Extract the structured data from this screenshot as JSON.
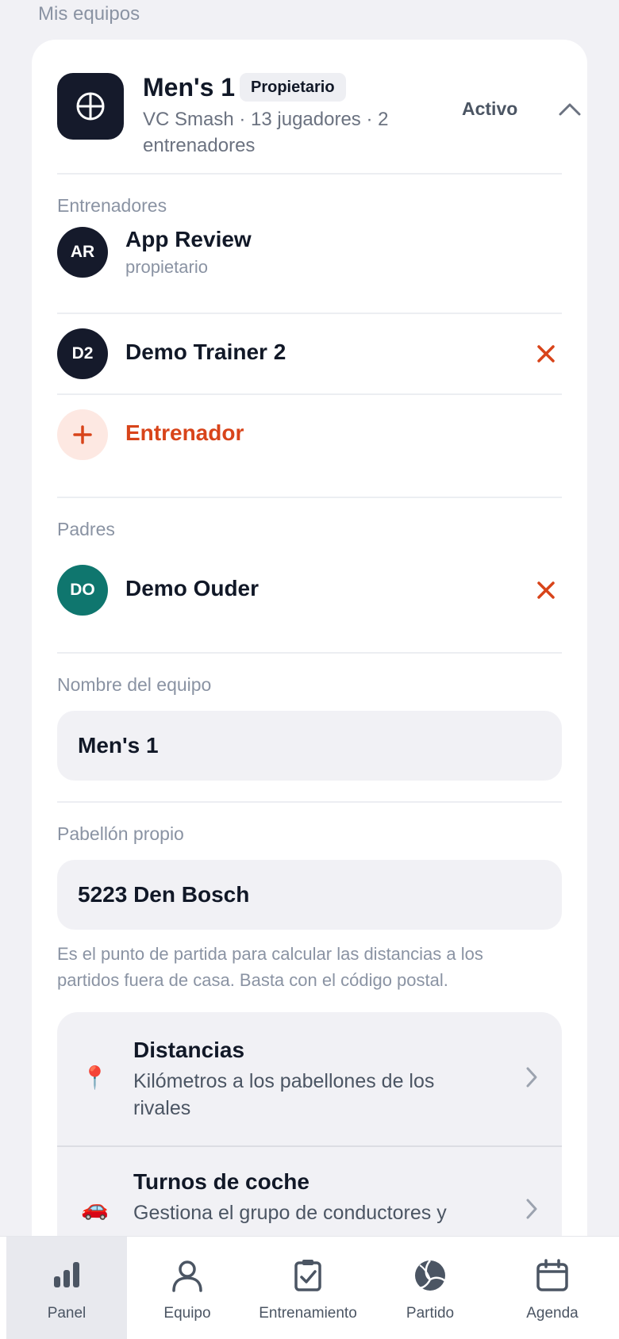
{
  "section_title": "Mis equipos",
  "team": {
    "name": "Men's 1",
    "badge": "Propietario",
    "subtitle_line1": "VC Smash · 13 jugadores · 2",
    "subtitle_line2": "entrenadores",
    "status": "Activo",
    "logo_icon": "volleyball-icon"
  },
  "trainers": {
    "label": "Entrenadores",
    "items": [
      {
        "initials": "AR",
        "name": "App Review",
        "role": "propietario",
        "color": "#151a2b"
      },
      {
        "initials": "D2",
        "name": "Demo Trainer 2",
        "color": "#151a2b"
      }
    ],
    "add_label": "Entrenador"
  },
  "parents": {
    "label": "Padres",
    "items": [
      {
        "initials": "DO",
        "name": "Demo Ouder",
        "color": "#0f766e"
      }
    ]
  },
  "team_name_field": {
    "label": "Nombre del equipo",
    "value": "Men's 1"
  },
  "home_venue_field": {
    "label": "Pabellón propio",
    "value": "5223 Den Bosch",
    "help_line1": "Es el punto de partida para calcular las distancias a los",
    "help_line2": "partidos fuera de casa. Basta con el código postal."
  },
  "settings_links": [
    {
      "icon": "📍",
      "title": "Distancias",
      "desc_line1": "Kilómetros a los pabellones de los",
      "desc_line2": "rivales"
    },
    {
      "icon": "🚗",
      "title": "Turnos de coche",
      "desc_line1": "Gestiona el grupo de conductores y",
      "desc_line2": ""
    }
  ],
  "tabs": [
    {
      "label": "Panel",
      "icon": "bar-chart-icon",
      "active": true
    },
    {
      "label": "Equipo",
      "icon": "person-icon",
      "active": false
    },
    {
      "label": "Entrenamiento",
      "icon": "checklist-icon",
      "active": false
    },
    {
      "label": "Partido",
      "icon": "volleyball-icon",
      "active": false
    },
    {
      "label": "Agenda",
      "icon": "calendar-icon",
      "active": false
    }
  ],
  "colors": {
    "accent": "#d8441a",
    "dark": "#151a2b",
    "teal": "#0f766e",
    "background": "#f1f1f5"
  }
}
